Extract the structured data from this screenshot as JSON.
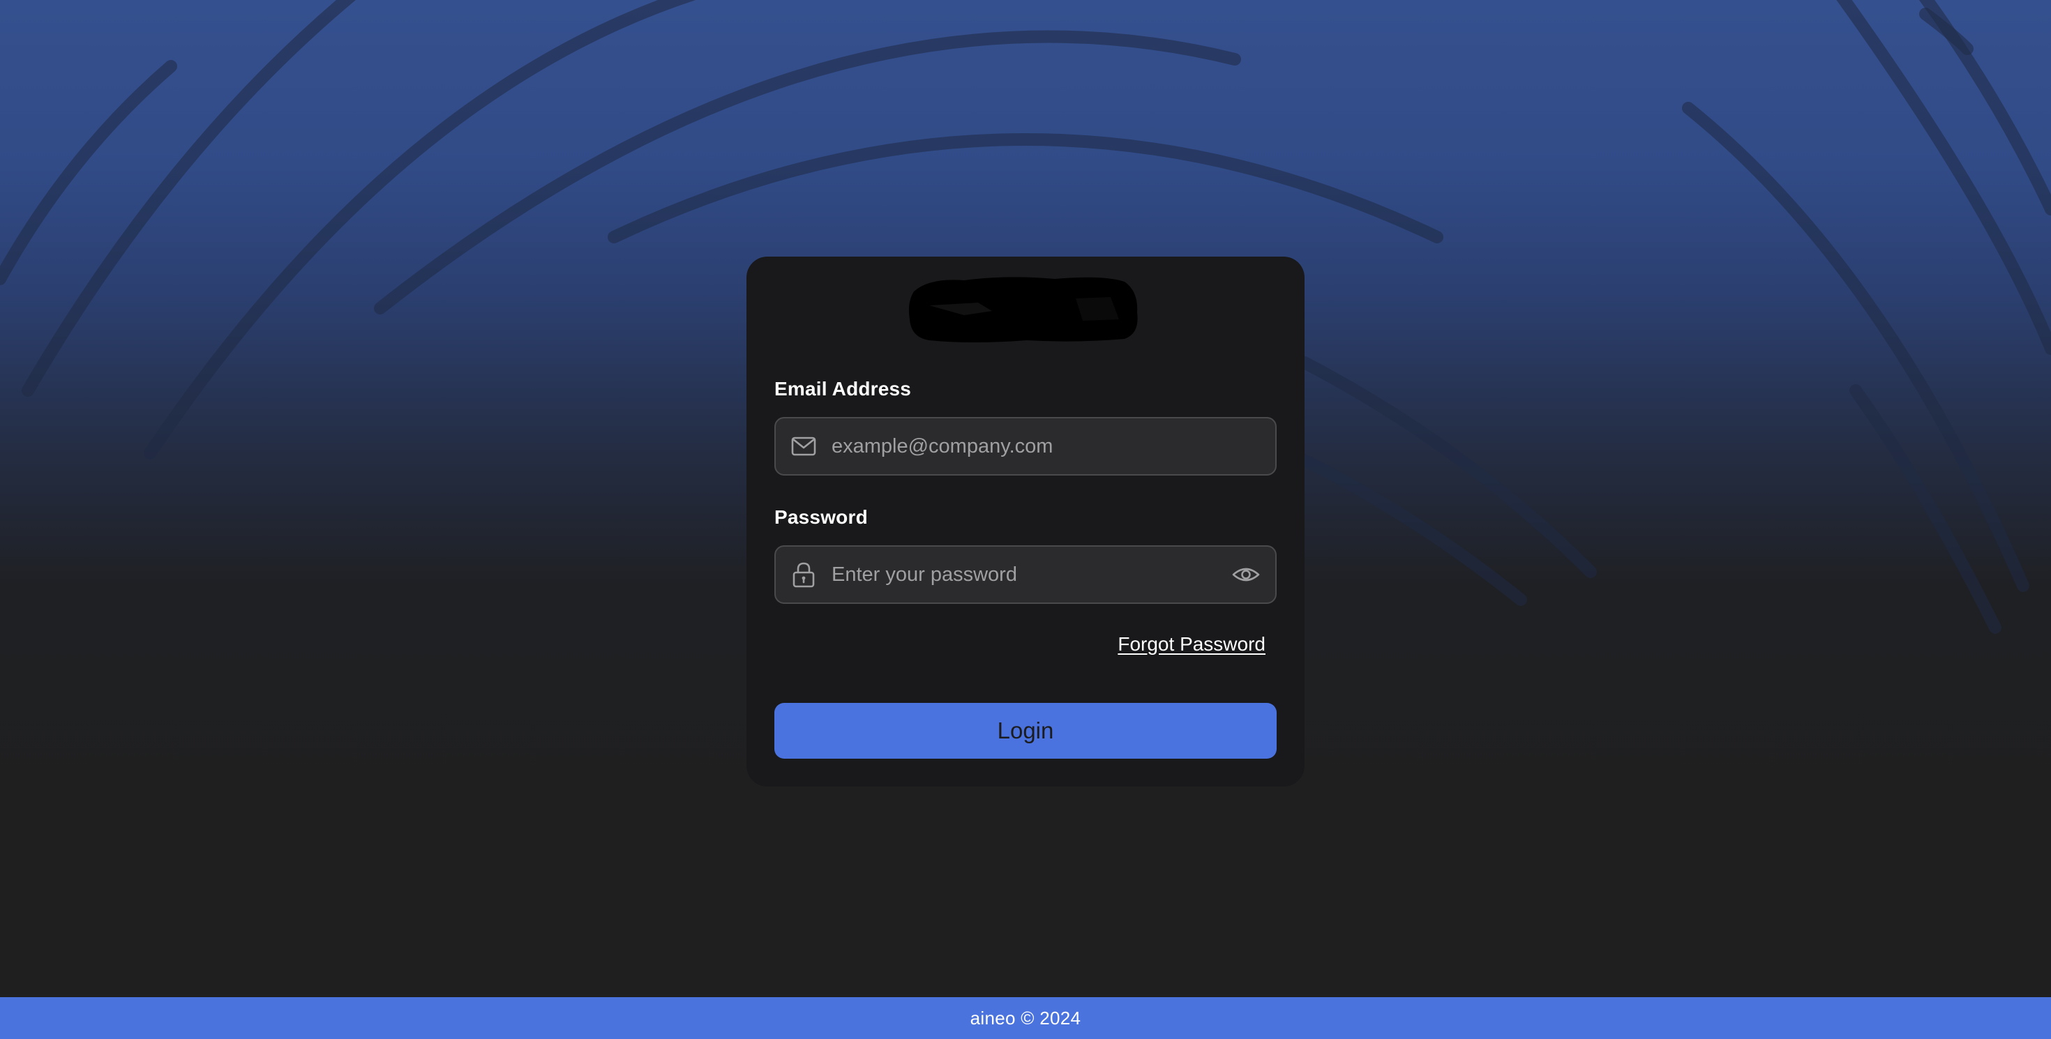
{
  "app": {
    "logo_name": "redacted-logo"
  },
  "form": {
    "email_label": "Email Address",
    "email_placeholder": "example@company.com",
    "email_value": "",
    "password_label": "Password",
    "password_placeholder": "Enter your password",
    "password_value": "",
    "forgot_label": "Forgot Password",
    "login_label": "Login"
  },
  "icons": {
    "email": "mail-icon",
    "password": "lock-icon",
    "toggle_visibility": "eye-icon"
  },
  "footer": {
    "text": "aineo © 2024"
  },
  "colors": {
    "accent": "#4a73e0",
    "card_background": "#19191b",
    "page_top": "#35508e",
    "page_bottom": "#1f1f1f",
    "footer": "#4b73dd"
  }
}
